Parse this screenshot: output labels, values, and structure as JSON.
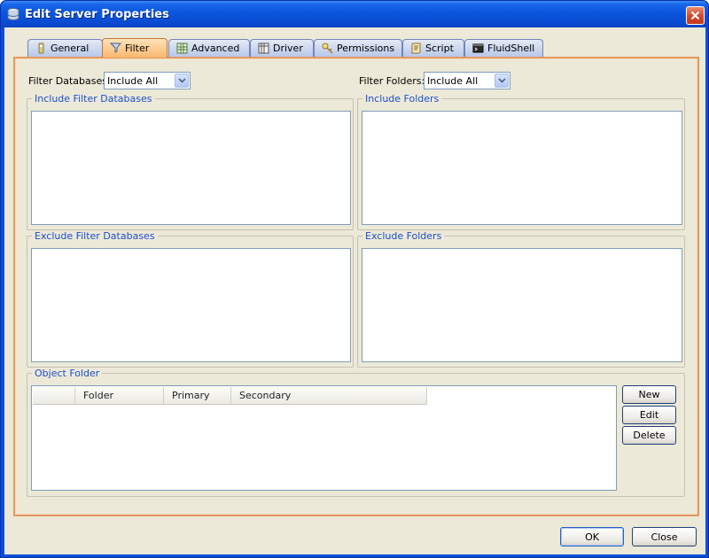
{
  "window": {
    "title": "Edit Server Properties"
  },
  "tabs": [
    {
      "label": "General",
      "icon": "general-icon",
      "active": false
    },
    {
      "label": "Filter",
      "icon": "filter-icon",
      "active": true
    },
    {
      "label": "Advanced",
      "icon": "advanced-icon",
      "active": false
    },
    {
      "label": "Driver",
      "icon": "driver-icon",
      "active": false
    },
    {
      "label": "Permissions",
      "icon": "permissions-icon",
      "active": false
    },
    {
      "label": "Script",
      "icon": "script-icon",
      "active": false
    },
    {
      "label": "FluidShell",
      "icon": "fluidshell-icon",
      "active": false
    }
  ],
  "filter": {
    "databases_label": "Filter Databases",
    "databases_value": "Include All",
    "folders_label": "Filter Folders:",
    "folders_value": "Include All"
  },
  "groups": {
    "include_databases": "Include Filter Databases",
    "include_folders": "Include Folders",
    "exclude_databases": "Exclude Filter Databases",
    "exclude_folders": "Exclude Folders",
    "object_folder": "Object Folder"
  },
  "object_table": {
    "columns": [
      "",
      "Folder",
      "Primary",
      "Secondary"
    ]
  },
  "object_buttons": {
    "new": "New",
    "edit": "Edit",
    "delete": "Delete"
  },
  "dialog_buttons": {
    "ok": "OK",
    "close": "Close"
  },
  "colors": {
    "titlebar": "#0b55de",
    "active_tab": "#f9b870",
    "group_title": "#1c4ecf",
    "dialog_bg": "#ece9d8"
  }
}
